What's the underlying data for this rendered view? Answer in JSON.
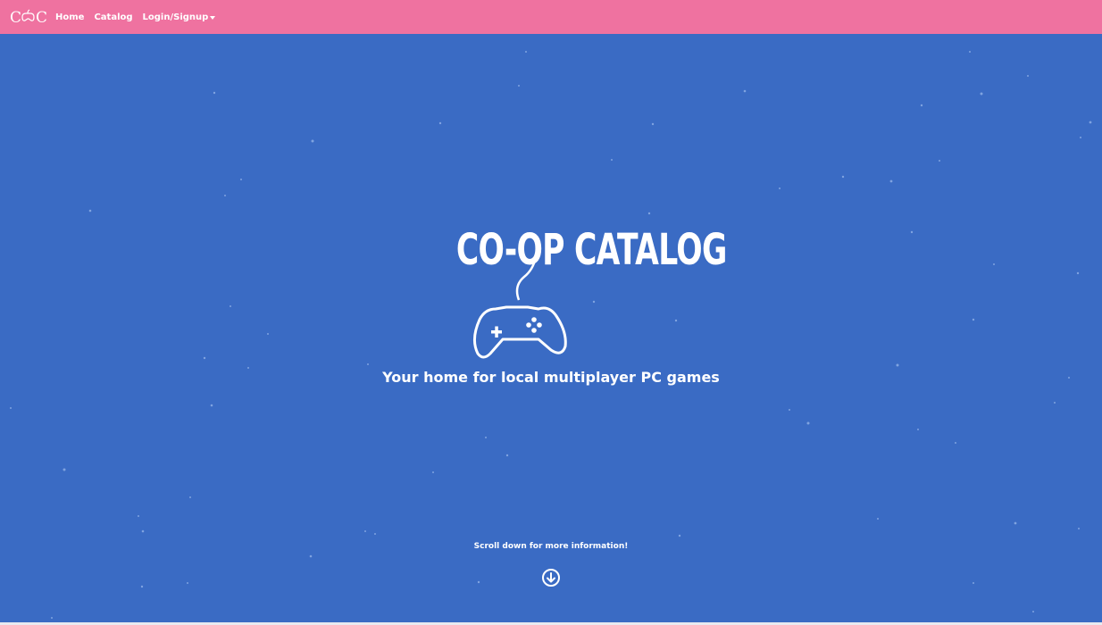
{
  "nav": {
    "logo_text": "CoC",
    "items": [
      {
        "label": "Home"
      },
      {
        "label": "Catalog"
      },
      {
        "label": "Login/Signup"
      }
    ]
  },
  "hero": {
    "title": "CO-OP CATALOG",
    "tagline": "Your home for local multiplayer PC games",
    "scroll_text": "Scroll down for more information!",
    "controller_icon": "gamepad-icon",
    "scroll_icon": "arrow-down-circle-icon"
  },
  "colors": {
    "navbar": "#ef72a0",
    "background": "#3a6bc4",
    "text": "#ffffff"
  }
}
